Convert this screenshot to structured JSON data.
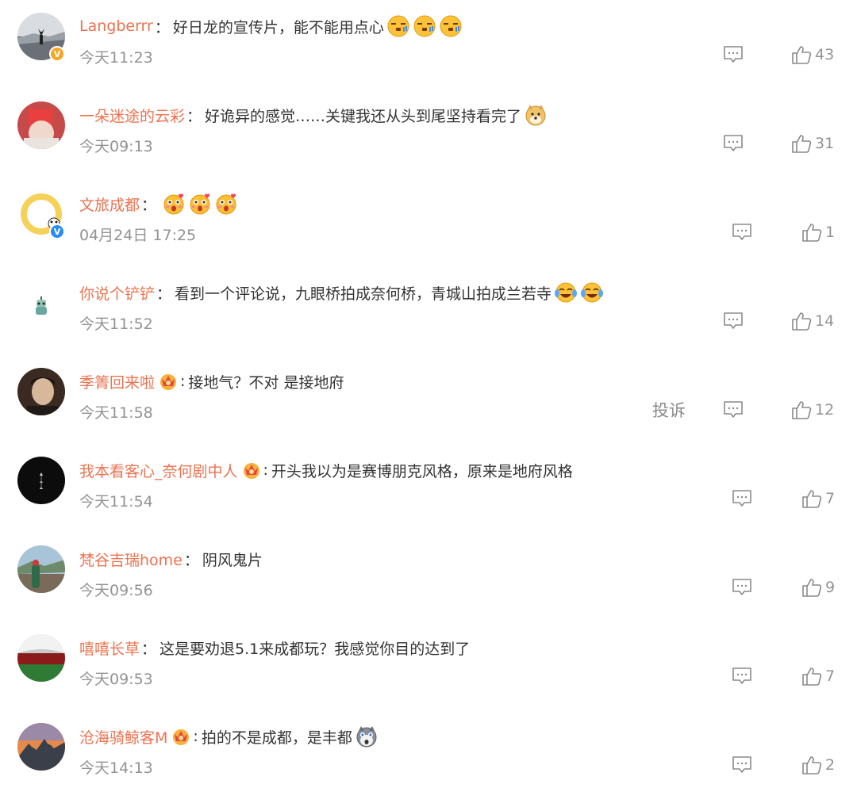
{
  "icons": {
    "reply": "comment-reply-icon",
    "like": "thumbs-up-icon",
    "vip": "crown-vip-icon",
    "verified": "verified-badge-icon"
  },
  "colors": {
    "username": "#eb7350",
    "text": "#333333",
    "meta": "#939393",
    "verified_gold": "#f5a623",
    "verified_blue": "#2a8cf0"
  },
  "comments": [
    {
      "username": "Langberrr",
      "separator": "：",
      "text": "好日龙的宣传片，能不能用点心",
      "time": "今天11:23",
      "likes": "43",
      "emojis": [
        "sleepy-face-emoji",
        "sleepy-face-emoji",
        "sleepy-face-emoji"
      ],
      "badge_glyph": "V"
    },
    {
      "username": "一朵迷途的云彩",
      "separator": "：",
      "text": "好诡异的感觉……关键我还从头到尾坚持看完了",
      "time": "今天09:13",
      "likes": "31",
      "emojis": [
        "doge-emoji"
      ]
    },
    {
      "username": "文旅成都",
      "separator": "：",
      "text": "",
      "time": "04月24日 17:25",
      "likes": "1",
      "emojis": [
        "heart-eyes-face-emoji",
        "heart-eyes-face-emoji",
        "heart-eyes-face-emoji"
      ],
      "badge_glyph": "V"
    },
    {
      "username": "你说个铲铲",
      "separator": "：",
      "text": "看到一个评论说，九眼桥拍成奈何桥，青城山拍成兰若寺",
      "time": "今天11:52",
      "likes": "14",
      "emojis": [
        "laughing-crying-emoji",
        "laughing-crying-emoji"
      ]
    },
    {
      "username": "季箐回来啦",
      "separator": ":",
      "text": "接地气？不对 是接地府",
      "time": "今天11:58",
      "likes": "12",
      "report": "投诉"
    },
    {
      "username": "我本看客心_奈何剧中人",
      "separator": ":",
      "text": "开头我以为是赛博朋克风格，原来是地府风格",
      "time": "今天11:54",
      "likes": "7"
    },
    {
      "username": "梵谷吉瑞home",
      "separator": "：",
      "text": "阴风鬼片",
      "time": "今天09:56",
      "likes": "9"
    },
    {
      "username": "嘻嘻长草",
      "separator": "：",
      "text": "这是要劝退5.1来成都玩？我感觉你目的达到了",
      "time": "今天09:53",
      "likes": "7"
    },
    {
      "username": "沧海骑鲸客M",
      "separator": ":",
      "text": "拍的不是成都，是丰都",
      "time": "今天14:13",
      "likes": "2",
      "emojis": [
        "shocked-husky-emoji"
      ]
    }
  ]
}
